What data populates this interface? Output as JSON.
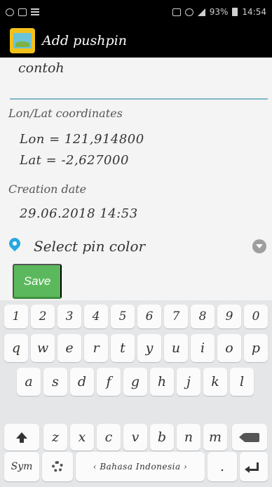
{
  "status_bar": {
    "battery_label": "93%",
    "time": "14:54"
  },
  "action_bar": {
    "title": "Add pushpin"
  },
  "form": {
    "name_value": "contoh",
    "coords_label": "Lon/Lat coordinates",
    "lon_text": "Lon = 121,914800",
    "lat_text": "Lat = -2,627000",
    "date_label": "Creation date",
    "date_value": "29.06.2018 14:53",
    "pin_color_label": "Select pin color",
    "save_label": "Save"
  },
  "colors": {
    "accent_underline": "#7fb7c9",
    "save_green": "#5cb85c",
    "pin_blue": "#29a8e0"
  },
  "keyboard": {
    "row_numbers": [
      "1",
      "2",
      "3",
      "4",
      "5",
      "6",
      "7",
      "8",
      "9",
      "0"
    ],
    "row_top": [
      "q",
      "w",
      "e",
      "r",
      "t",
      "y",
      "u",
      "i",
      "o",
      "p"
    ],
    "row_mid": [
      "a",
      "s",
      "d",
      "f",
      "g",
      "h",
      "j",
      "k",
      "l"
    ],
    "row_bottom": [
      "z",
      "x",
      "c",
      "v",
      "b",
      "n",
      "m"
    ],
    "sym_label": "Sym",
    "space_label": "‹ Bahasa Indonesia ›",
    "period_label": "."
  }
}
